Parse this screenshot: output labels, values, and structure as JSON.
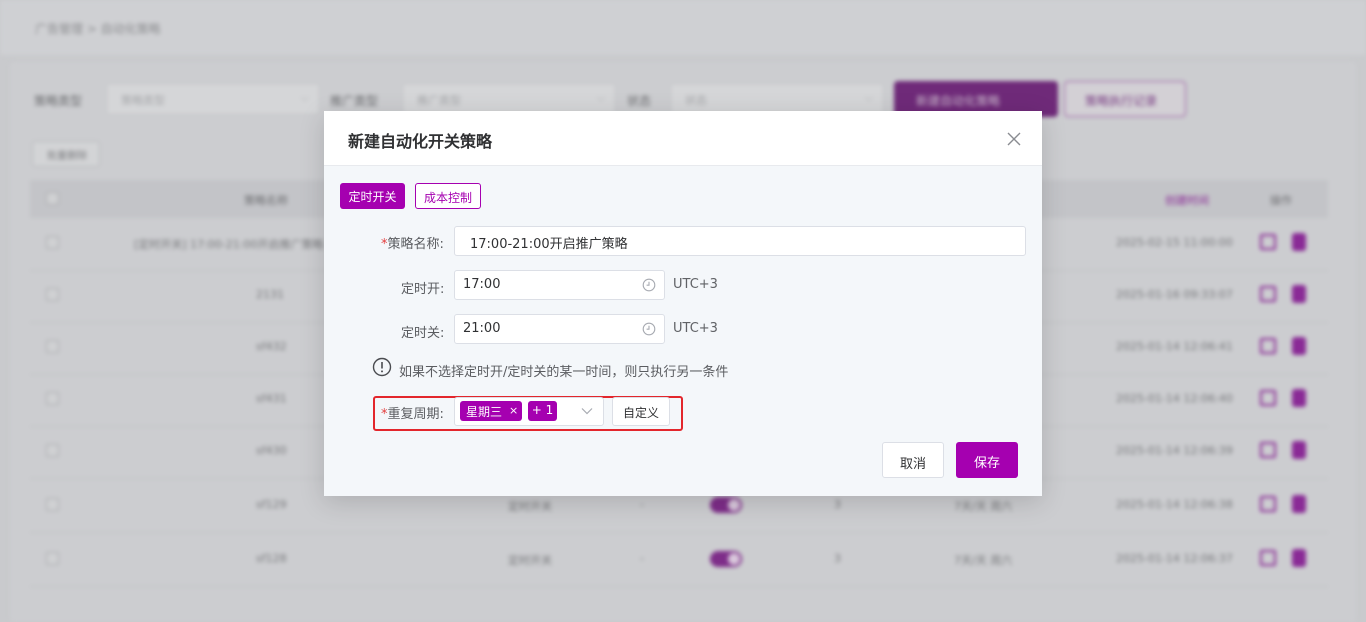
{
  "background": {
    "breadcrumb": "广告管理 > 自动化策略",
    "filters": [
      {
        "label": "策略类型",
        "placeholder": "策略类型"
      },
      {
        "label": "推广类型",
        "placeholder": "推广类型"
      },
      {
        "label": "状态",
        "placeholder": "状态"
      }
    ],
    "primary_button": "新建自动化策略",
    "outline_button": "策略执行记录",
    "batch_button": "批量删除",
    "table_headers": [
      "策略名称",
      "创建时间",
      "操作"
    ],
    "rows": [
      {
        "name": "[定时开关] 17:00-21:00开启推广策略",
        "time": "2025-02-15 11:00:00",
        "switch": false
      },
      {
        "name": "2131",
        "time": "2025-01-16 09:33:07",
        "switch": false
      },
      {
        "name": "sf432",
        "time": "2025-01-14 12:06:41",
        "switch": false
      },
      {
        "name": "sf431",
        "time": "2025-01-14 12:06:40",
        "switch": false
      },
      {
        "name": "sf430",
        "time": "2025-01-14 12:06:39",
        "switch": false
      },
      {
        "name": "sf129",
        "type": "定时开关",
        "dash": "-",
        "count": "3",
        "schedule": "7天/天 周六",
        "time": "2025-01-14 12:06:38",
        "switch": true
      },
      {
        "name": "sf128",
        "type": "定时开关",
        "dash": "-",
        "count": "3",
        "schedule": "7天/天 周六",
        "time": "2025-01-14 12:06:37",
        "switch": true
      }
    ]
  },
  "modal": {
    "title": "新建自动化开关策略",
    "tabs": [
      {
        "label": "定时开关",
        "active": true
      },
      {
        "label": "成本控制",
        "active": false
      }
    ],
    "fields": {
      "name": {
        "required_mark": "*",
        "label": "策略名称:",
        "value": "17:00-21:00开启推广策略"
      },
      "on_time": {
        "label": "定时开:",
        "value": "17:00",
        "timezone": "UTC+3"
      },
      "off_time": {
        "label": "定时关:",
        "value": "21:00",
        "timezone": "UTC+3"
      },
      "hint": "如果不选择定时开/定时关的某一时间，则只执行另一条件",
      "repeat": {
        "required_mark": "*",
        "label": "重复周期:",
        "tags": [
          "星期三"
        ],
        "tag_close": "×",
        "more_count": "+ 1",
        "custom_button": "自定义"
      }
    },
    "buttons": {
      "cancel": "取消",
      "save": "保存"
    }
  },
  "colors": {
    "accent": "#a500b0",
    "highlight": "#e3262c",
    "required": "#e33d3d"
  }
}
